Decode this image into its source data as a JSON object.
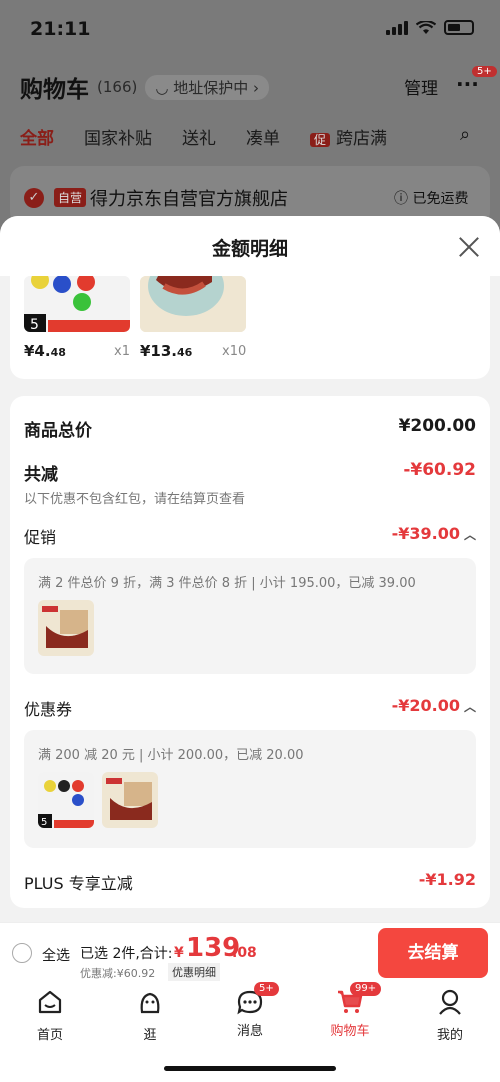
{
  "status": {
    "time": "21:11"
  },
  "header": {
    "title": "购物车",
    "count": "(166)",
    "address": "地址保护中",
    "manage": "管理",
    "more_badge": "5+"
  },
  "categories": {
    "items": [
      "全部",
      "国家补贴",
      "送礼",
      "凑单"
    ],
    "promo_tag": "促",
    "promo_label": "跨店满"
  },
  "shop": {
    "self_tag": "自营",
    "name": "得力京东自营官方旗舰店",
    "shipping": "已免运费"
  },
  "sheet": {
    "title": "金额明细",
    "products": [
      {
        "price_int": "¥4.",
        "price_dec": "48",
        "qty": "x1"
      },
      {
        "price_int": "¥13.",
        "price_dec": "46",
        "qty": "x10"
      }
    ],
    "total_label": "商品总价",
    "total_value": "¥200.00",
    "reduce_label": "共减",
    "reduce_value": "-¥60.92",
    "reduce_note": "以下优惠不包含红包，请在结算页查看",
    "promo_label": "促销",
    "promo_value": "-¥39.00",
    "promo_detail": "满 2 件总价 9 折，满 3 件总价 8 折 | 小计 195.00，已减 39.00",
    "coupon_label": "优惠券",
    "coupon_value": "-¥20.00",
    "coupon_detail": "满 200 减 20 元 | 小计 200.00，已减 20.00",
    "plus_label": "PLUS 专享立减",
    "plus_value": "-¥1.92"
  },
  "checkout": {
    "select_all": "全选",
    "selected": "已选 2件,合计:",
    "currency": "¥",
    "total_int": "139",
    "total_dec": ".08",
    "discount": "优惠减:¥60.92",
    "detail_link": "优惠明细",
    "pay_button": "去结算"
  },
  "tabbar": {
    "items": [
      {
        "label": "首页"
      },
      {
        "label": "逛"
      },
      {
        "label": "消息",
        "badge": "5+"
      },
      {
        "label": "购物车",
        "badge": "99+"
      },
      {
        "label": "我的"
      }
    ]
  },
  "colors": {
    "accent": "#e4393c",
    "pay_button": "#f4473f"
  }
}
